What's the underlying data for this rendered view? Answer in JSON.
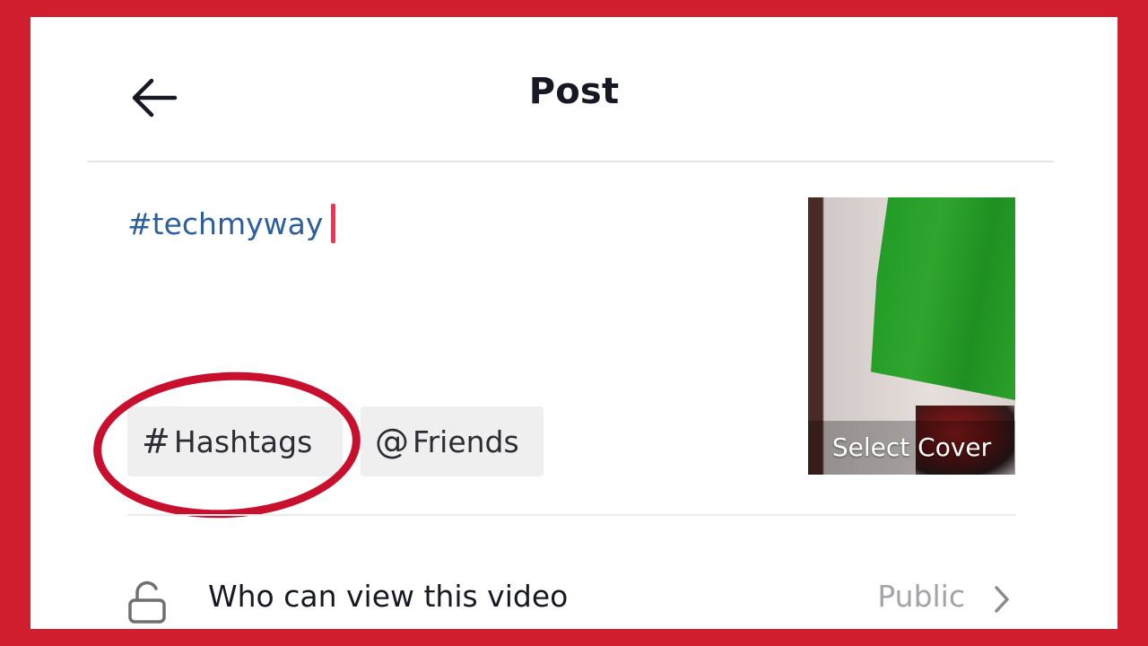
{
  "header": {
    "title": "Post",
    "back_icon": "arrow-left-icon"
  },
  "caption": {
    "text": "#techmyway"
  },
  "chips": {
    "hashtags": {
      "symbol": "#",
      "label": "Hashtags"
    },
    "friends": {
      "symbol": "@",
      "label": "Friends"
    }
  },
  "cover": {
    "label": "Select Cover"
  },
  "privacy": {
    "icon": "lock-open-icon",
    "label": "Who can view this video",
    "value": "Public",
    "chevron_icon": "chevron-right-icon"
  },
  "colors": {
    "frame_border": "#d11f2f",
    "highlight": "#c8102e",
    "caret": "#fe2c55",
    "hashtag_text": "#2b5f9e"
  }
}
